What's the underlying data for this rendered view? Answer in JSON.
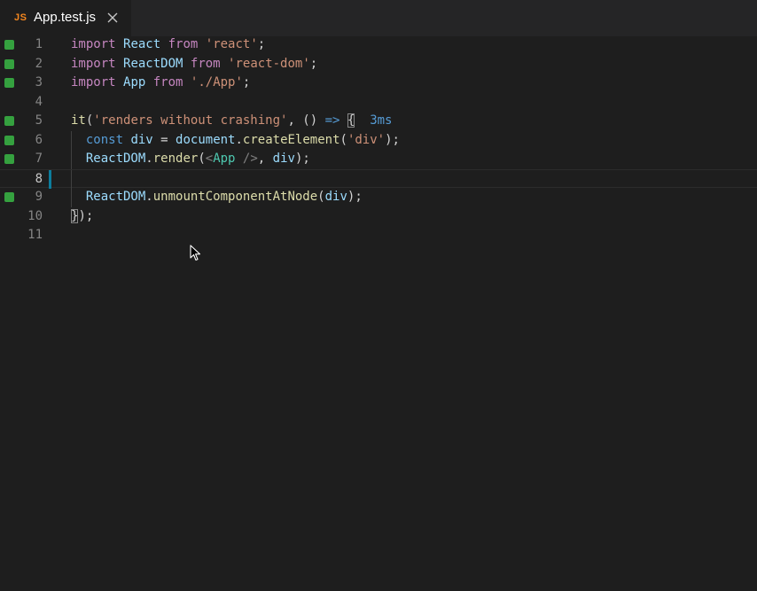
{
  "tab": {
    "lang_badge": "JS",
    "title": "App.test.js"
  },
  "colors": {
    "coverage_covered": "#35a13f",
    "change_indicator": "#0c7d9d",
    "keyword": "#c586c0",
    "string": "#ce9178",
    "function": "#dcdcaa",
    "variable": "#9cdcfe"
  },
  "lines": [
    {
      "number": "1",
      "tokens": [
        "import",
        " ",
        "React",
        " ",
        "from",
        " ",
        "'react'",
        ";"
      ]
    },
    {
      "number": "2",
      "tokens": [
        "import",
        " ",
        "ReactDOM",
        " ",
        "from",
        " ",
        "'react-dom'",
        ";"
      ]
    },
    {
      "number": "3",
      "tokens": [
        "import",
        " ",
        "App",
        " ",
        "from",
        " ",
        "'./App'",
        ";"
      ]
    },
    {
      "number": "4",
      "tokens": []
    },
    {
      "number": "5",
      "tokens": [
        "it",
        "(",
        "'renders without crashing'",
        ", () ",
        "=>",
        " ",
        "{",
        "  ",
        "3ms"
      ]
    },
    {
      "number": "6",
      "tokens": [
        "  ",
        "const",
        " ",
        "div",
        " = ",
        "document",
        ".",
        "createElement",
        "(",
        "'div'",
        ");"
      ]
    },
    {
      "number": "7",
      "tokens": [
        "  ",
        "ReactDOM",
        ".",
        "render",
        "(",
        "<",
        "App",
        " />",
        ", ",
        "div",
        ");"
      ]
    },
    {
      "number": "8",
      "tokens": []
    },
    {
      "number": "9",
      "tokens": [
        "  ",
        "ReactDOM",
        ".",
        "unmountComponentAtNode",
        "(",
        "div",
        ");"
      ]
    },
    {
      "number": "10",
      "tokens": [
        "}",
        ");"
      ]
    },
    {
      "number": "11",
      "tokens": []
    }
  ]
}
